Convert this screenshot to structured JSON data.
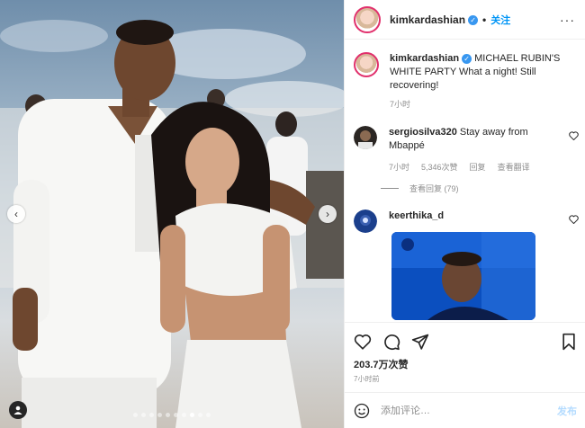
{
  "post": {
    "author": "kimkardashian",
    "follow_label": "关注",
    "separator": "•",
    "more_label": "···",
    "caption": "MICHAEL RUBIN'S WHITE PARTY What a night! Still recovering!",
    "caption_time": "7小时",
    "likes": "203.7万次赞",
    "posted": "7小时前"
  },
  "media": {
    "prev_label": "‹",
    "next_label": "›",
    "carousel_total": 10,
    "carousel_active_index": 7
  },
  "comments": [
    {
      "user": "sergiosilva320",
      "text": "Stay away from Mbappé",
      "time": "7小时",
      "likes": "5,346次赞",
      "reply_label": "回复",
      "translate_label": "查看翻译",
      "view_replies": "查看回复 (79)"
    },
    {
      "user": "keerthika_d",
      "text": ""
    }
  ],
  "composer": {
    "placeholder": "添加评论…",
    "post_label": "发布"
  },
  "icons": [
    "heart-icon",
    "comment-icon",
    "share-icon",
    "bookmark-icon",
    "emoji-icon",
    "tag-user-icon",
    "more-icon",
    "verified-icon"
  ],
  "colors": {
    "accent": "#0095f6",
    "verified": "#3897f0",
    "muted": "#8e8e8e"
  }
}
